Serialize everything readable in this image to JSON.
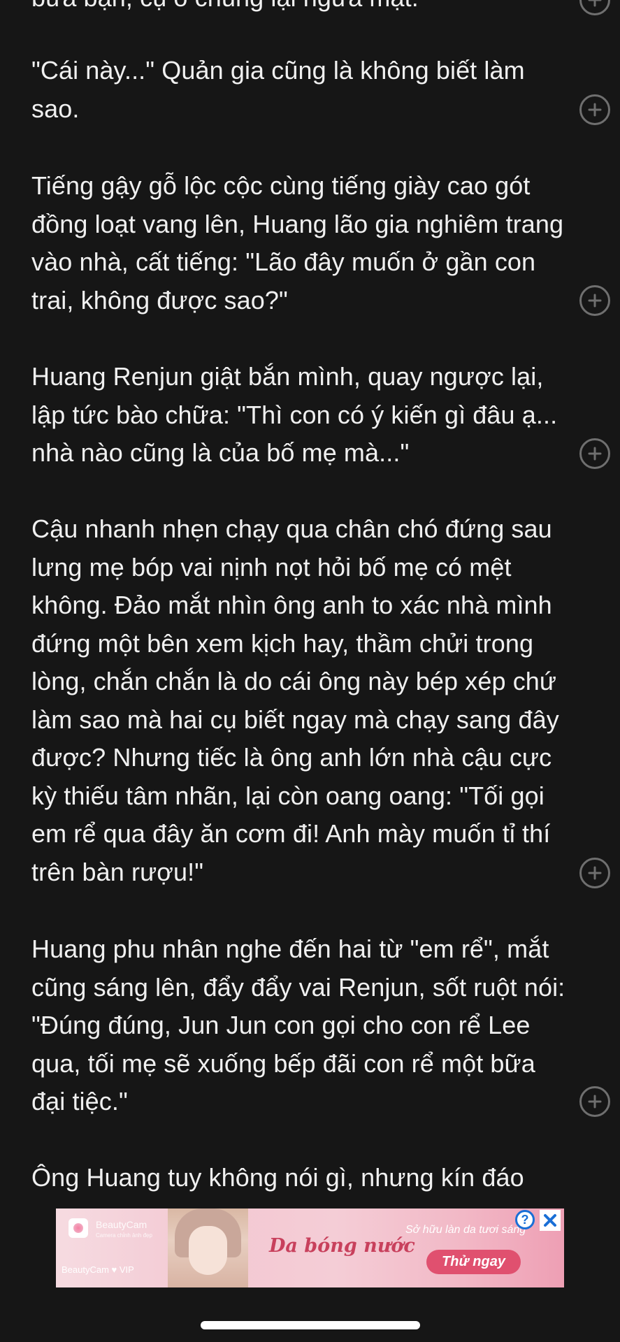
{
  "reader": {
    "paragraphs": [
      {
        "text": "bữa bận, cụ ổ chúng lại ngửa mặt."
      },
      {
        "text": "\"Cái này...\" Quản gia cũng là không biết làm\nsao."
      },
      {
        "text": "Tiếng gậy gỗ lộc cộc cùng tiếng giày cao gót\nđồng loạt vang lên, Huang lão gia nghiêm trang\nvào nhà, cất tiếng: \"Lão đây muốn ở gần con\ntrai, không được sao?\""
      },
      {
        "text": "Huang Renjun giật bắn mình, quay ngược lại,\nlập tức bào chữa: \"Thì con có ý kiến gì đâu ạ...\nnhà nào cũng là của bố mẹ mà...\""
      },
      {
        "text": "Cậu nhanh nhẹn chạy qua chân chó đứng sau\nlưng mẹ bóp vai nịnh nọt hỏi bố mẹ có mệt\nkhông. Đảo mắt nhìn ông anh to xác nhà mình\nđứng một bên xem kịch hay, thầm chửi trong\nlòng, chắn chắn là do cái ông này bép xép chứ\nlàm sao mà hai cụ biết ngay mà chạy sang đây\nđược? Nhưng tiếc là ông anh lớn nhà cậu cực\nkỳ thiếu tâm nhãn, lại còn oang oang: \"Tối gọi\nem rể qua đây ăn cơm đi! Anh mày muốn tỉ thí\ntrên bàn rượu!\""
      },
      {
        "text": "Huang phu nhân nghe đến hai từ \"em rể\", mắt\ncũng sáng lên, đẩy đẩy vai Renjun, sốt ruột nói:\n\"Đúng đúng, Jun Jun con gọi cho con rể Lee\nqua, tối mẹ sẽ xuống bếp đãi con rể một bữa\nđại tiệc.\""
      },
      {
        "text": "Ông Huang tuy không nói gì, nhưng kín đáo"
      }
    ],
    "comment_icon": "plus-circle-icon"
  },
  "ad": {
    "brand": "BeautyCam",
    "brand_sub": "Camera chỉnh ảnh đẹp",
    "vip_label": "BeautyCam ♥ VIP",
    "headline": "Da bóng nước",
    "tagline": "Sở hữu làn da tươi sáng",
    "cta": "Thử ngay",
    "info_label": "?",
    "close_icon": "close-icon"
  }
}
